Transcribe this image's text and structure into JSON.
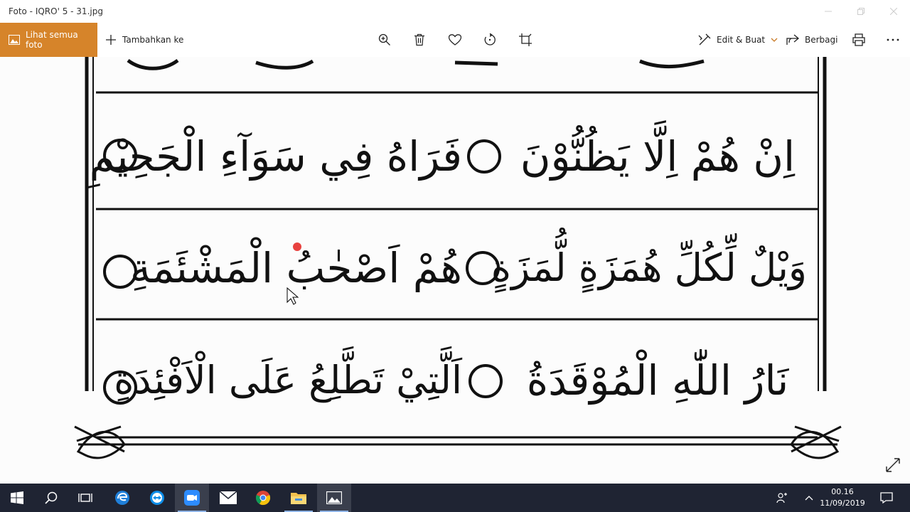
{
  "window": {
    "title": "Foto - IQRO' 5 - 31.jpg"
  },
  "toolbar": {
    "all_photos_label": "Lihat semua foto",
    "add_to_label": "Tambahkan ke",
    "edit_create_label": "Edit & Buat",
    "share_label": "Berbagi"
  },
  "image": {
    "rows": [
      {
        "left_text": "فَرَاهُ فِي سَوَآءِ الْجَحِيْمِ",
        "right_text": "اِنْ هُمْ اِلَّا يَظُنُّوْنَ"
      },
      {
        "left_text": "هُمْ اَصْحٰبُ الْمَشْئَمَةِ",
        "right_text": "وَيْلٌ لِّكُلِّ هُمَزَةٍ لُّمَزَةٍ"
      },
      {
        "left_text": "اَلَّتِيْ تَطَّلِعُ عَلَى الْاَفْئِدَةِ",
        "right_text": "نَارُ اللّٰهِ الْمُوْقَدَةُ"
      }
    ]
  },
  "taskbar": {
    "time": "00.16",
    "date": "11/09/2019"
  },
  "colors": {
    "accent": "#d6842a",
    "taskbar": "#1f2433"
  }
}
